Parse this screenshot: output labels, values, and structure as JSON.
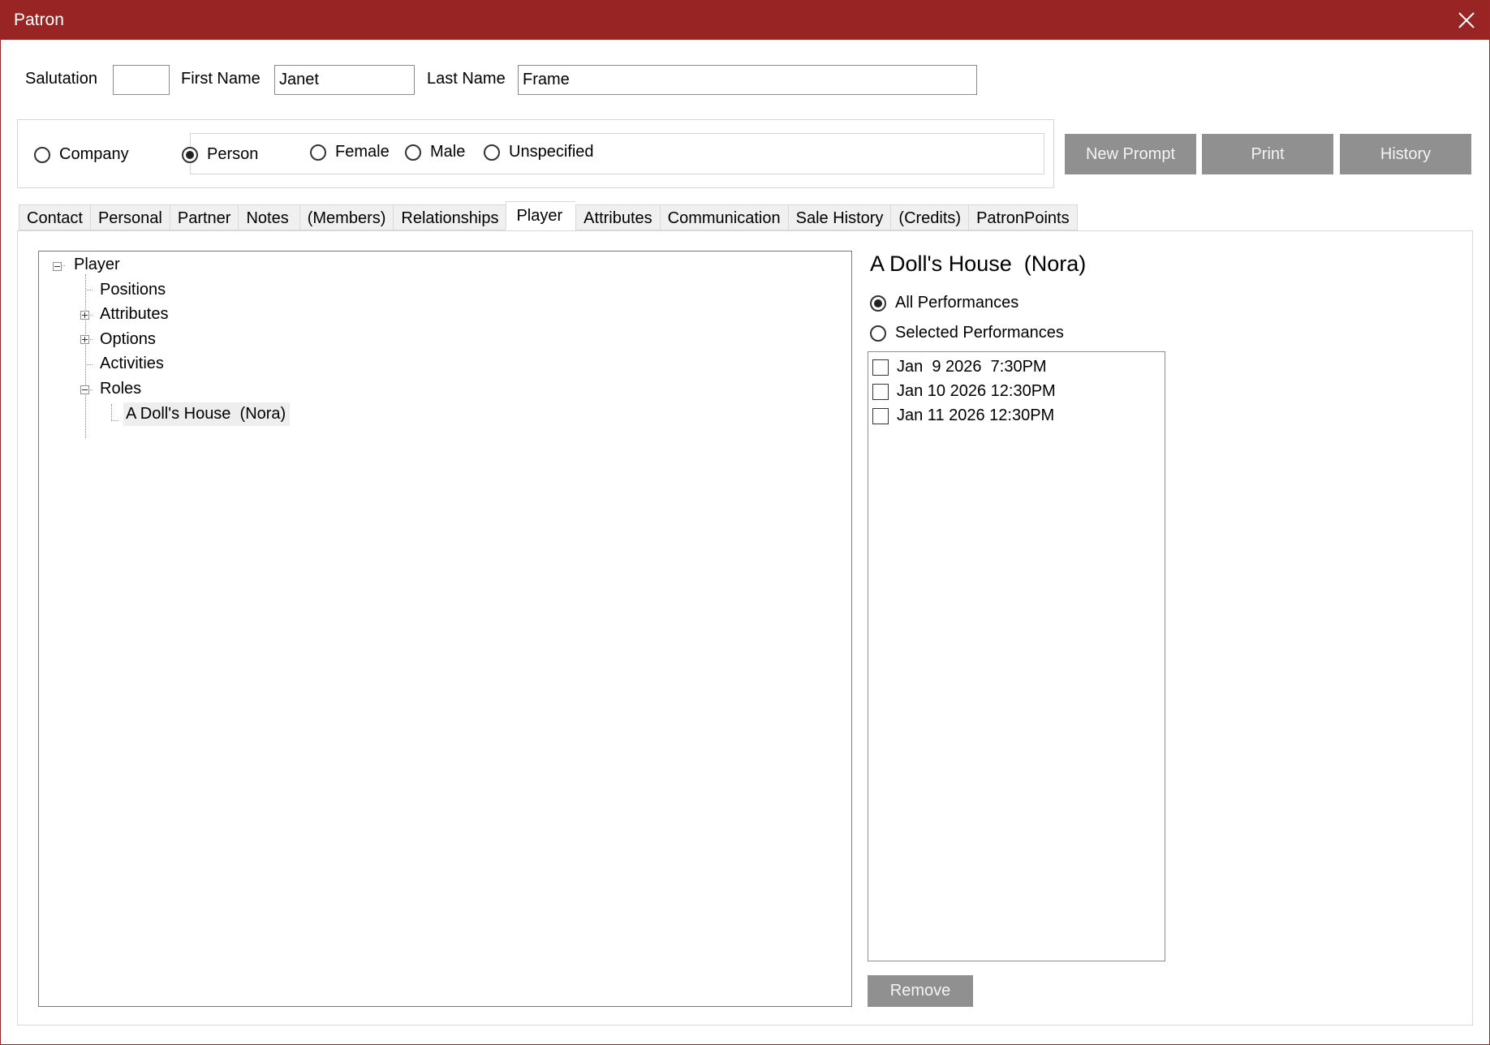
{
  "window": {
    "title": "Patron",
    "close_icon": "close-icon"
  },
  "name": {
    "salutation_label": "Salutation",
    "salutation_value": "",
    "first_name_label": "First Name",
    "first_name_value": "Janet",
    "last_name_label": "Last Name",
    "last_name_value": "Frame"
  },
  "patron_type": {
    "company_label": "Company",
    "person_label": "Person",
    "selected": "Person"
  },
  "gender": {
    "female_label": "Female",
    "male_label": "Male",
    "unspecified_label": "Unspecified",
    "selected": ""
  },
  "buttons": {
    "new_prompt": "New Prompt",
    "print": "Print",
    "history": "History",
    "remove": "Remove"
  },
  "tabs": [
    {
      "label": "Contact"
    },
    {
      "label": "Personal"
    },
    {
      "label": "Partner"
    },
    {
      "label": "Notes"
    },
    {
      "label": "(Members)"
    },
    {
      "label": "Relationships"
    },
    {
      "label": "Player",
      "active": true
    },
    {
      "label": "Attributes"
    },
    {
      "label": "Communication"
    },
    {
      "label": "Sale History"
    },
    {
      "label": "(Credits)"
    },
    {
      "label": "PatronPoints"
    }
  ],
  "tree": {
    "root": "Player",
    "positions": "Positions",
    "attributes": "Attributes",
    "options": "Options",
    "activities": "Activities",
    "roles": "Roles",
    "role_item": "A Doll's House  (Nora)"
  },
  "role_detail": {
    "title": "A Doll's House  (Nora)",
    "all_performances_label": "All Performances",
    "selected_performances_label": "Selected Performances",
    "selected_mode": "All Performances",
    "performances": [
      {
        "label": "Jan  9 2026  7:30PM",
        "checked": false
      },
      {
        "label": "Jan 10 2026 12:30PM",
        "checked": false
      },
      {
        "label": "Jan 11 2026 12:30PM",
        "checked": false
      }
    ]
  }
}
